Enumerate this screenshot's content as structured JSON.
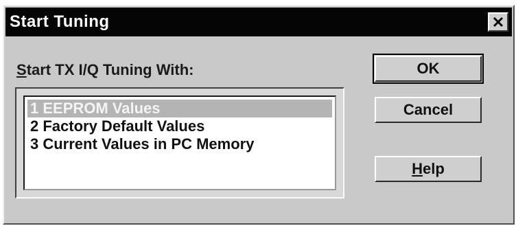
{
  "window": {
    "title": "Start Tuning"
  },
  "group": {
    "label_accel": "S",
    "label_rest": "tart TX I/Q Tuning With:"
  },
  "list": {
    "items": [
      {
        "label": "1 EEPROM Values",
        "selected": true
      },
      {
        "label": "2 Factory Default Values",
        "selected": false
      },
      {
        "label": "3 Current Values in PC Memory",
        "selected": false
      }
    ]
  },
  "buttons": {
    "ok_label": "OK",
    "cancel_label": "Cancel",
    "help_accel": "H",
    "help_rest": "elp"
  },
  "icons": {
    "close": "close-icon"
  },
  "colors": {
    "titlebar": "#050505",
    "selection": "#b4b4b4",
    "dialog_bg": "#c9c9c9"
  }
}
